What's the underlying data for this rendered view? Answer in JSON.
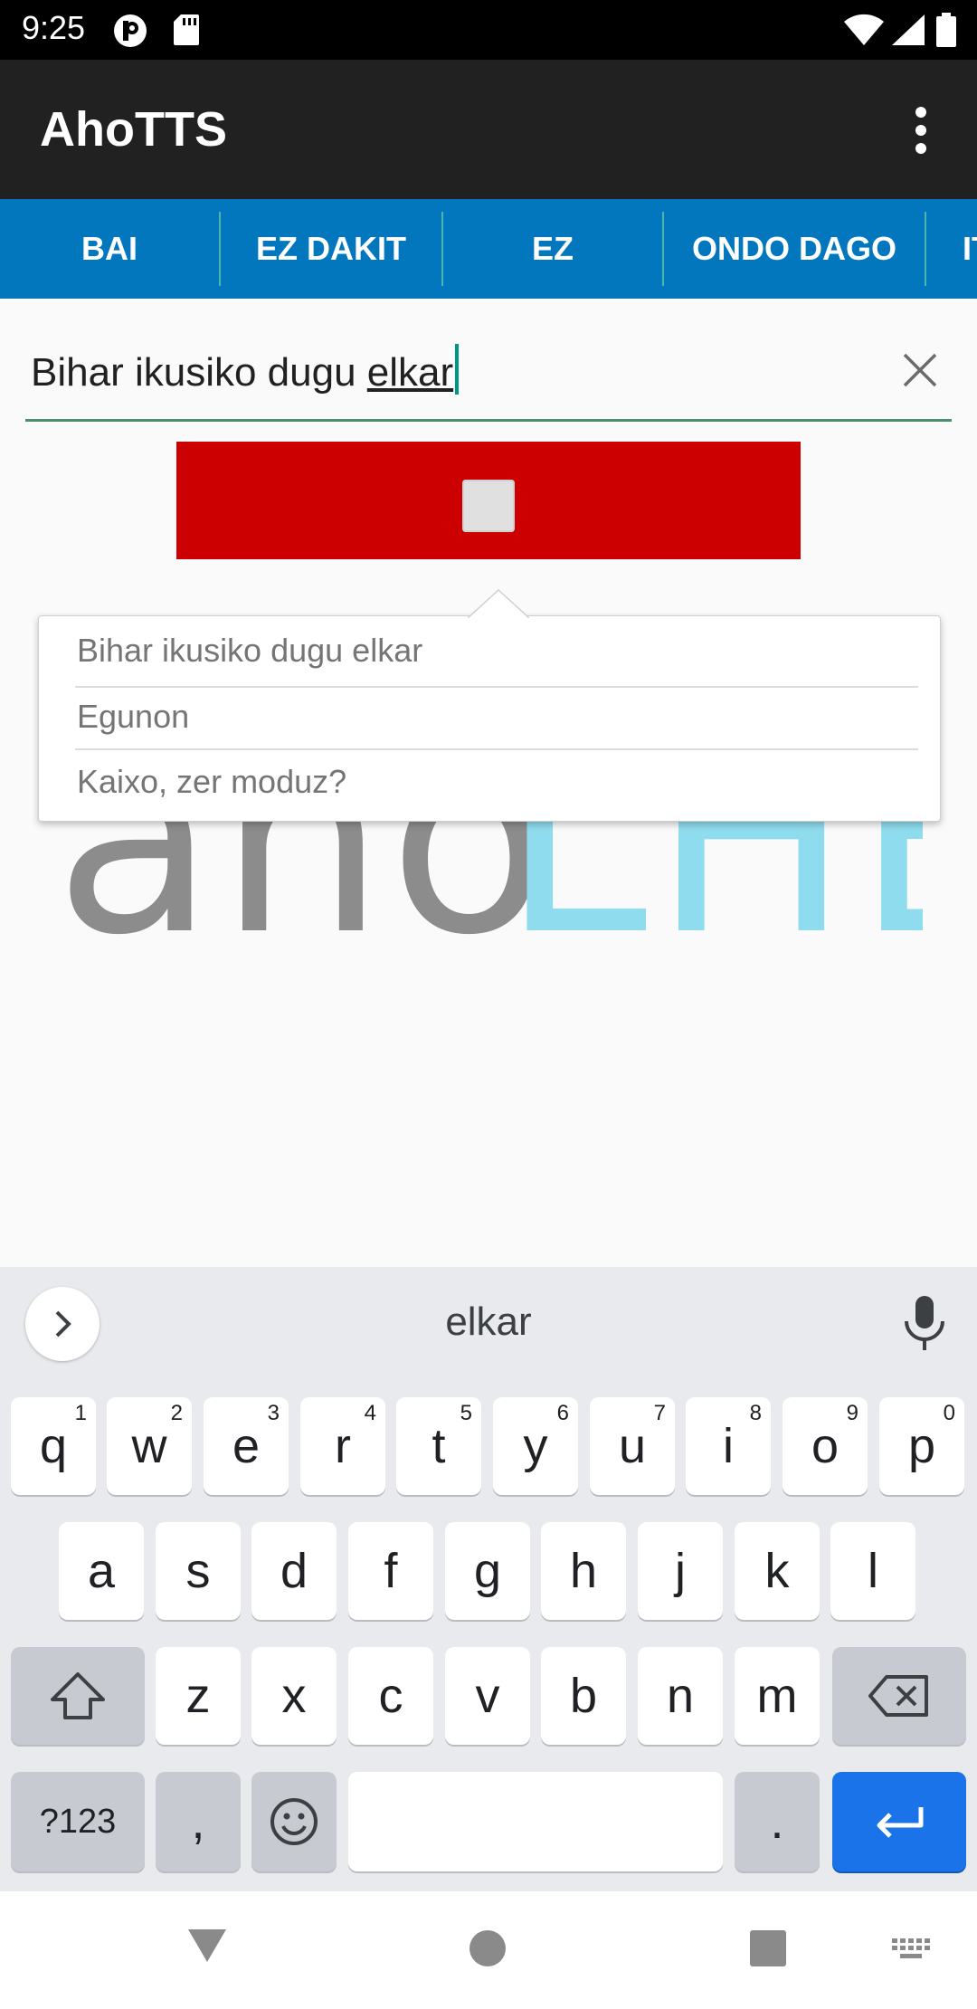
{
  "status_bar": {
    "time": "9:25"
  },
  "app_bar": {
    "title": "AhoTTS"
  },
  "tabs": [
    {
      "label": "BAI"
    },
    {
      "label": "EZ DAKIT"
    },
    {
      "label": "EZ"
    },
    {
      "label": "ONDO DAGO"
    },
    {
      "label": "IT"
    }
  ],
  "input": {
    "text_before": "Bihar ikusiko dugu ",
    "text_underlined": "elkar"
  },
  "suggestions": [
    {
      "label": "Bihar ikusiko dugu elkar"
    },
    {
      "label": "Egunon"
    },
    {
      "label": "Kaixo, zer moduz?"
    }
  ],
  "logo": {
    "part1": "aho",
    "part2": "LHB",
    "color1": "#8c8c8c",
    "color2": "#8fdcee"
  },
  "keyboard": {
    "suggestion": "elkar",
    "row1": [
      {
        "key": "q",
        "hint": "1"
      },
      {
        "key": "w",
        "hint": "2"
      },
      {
        "key": "e",
        "hint": "3"
      },
      {
        "key": "r",
        "hint": "4"
      },
      {
        "key": "t",
        "hint": "5"
      },
      {
        "key": "y",
        "hint": "6"
      },
      {
        "key": "u",
        "hint": "7"
      },
      {
        "key": "i",
        "hint": "8"
      },
      {
        "key": "o",
        "hint": "9"
      },
      {
        "key": "p",
        "hint": "0"
      }
    ],
    "row2": [
      "a",
      "s",
      "d",
      "f",
      "g",
      "h",
      "j",
      "k",
      "l"
    ],
    "row3": [
      "z",
      "x",
      "c",
      "v",
      "b",
      "n",
      "m"
    ],
    "symbols_label": "?123",
    "comma": ",",
    "period": "."
  },
  "colors": {
    "tab_bar": "#0277bd",
    "app_bar": "#212121",
    "stop_button": "#cc0000",
    "enter_key": "#1a73e8"
  }
}
